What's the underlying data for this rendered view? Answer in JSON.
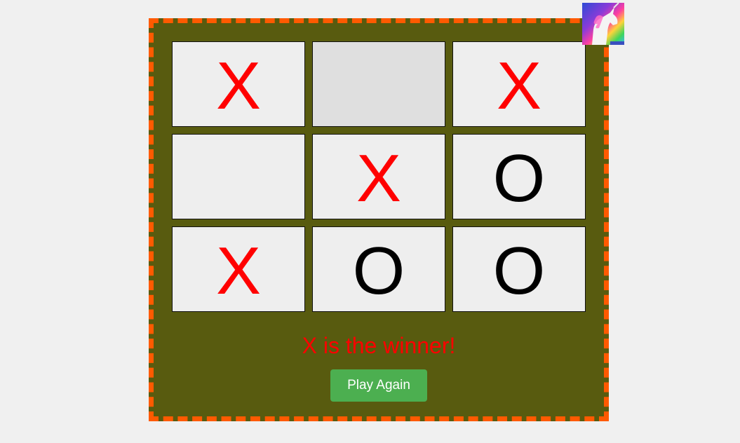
{
  "board": {
    "cells": [
      {
        "mark": "X",
        "player": "x"
      },
      {
        "mark": "",
        "player": "empty",
        "hover": true
      },
      {
        "mark": "X",
        "player": "x"
      },
      {
        "mark": "",
        "player": "empty"
      },
      {
        "mark": "X",
        "player": "x"
      },
      {
        "mark": "O",
        "player": "o"
      },
      {
        "mark": "X",
        "player": "x"
      },
      {
        "mark": "O",
        "player": "o"
      },
      {
        "mark": "O",
        "player": "o"
      }
    ]
  },
  "status": {
    "message": "X is the winner!"
  },
  "controls": {
    "play_again_label": "Play Again"
  },
  "colors": {
    "board_bg": "#585b0f",
    "border_dash": "#ff5a00",
    "x_mark": "#ff0000",
    "o_mark": "#000000",
    "button_bg": "#4caf50"
  },
  "decor": {
    "corner_image": "unicorn-rainbow-image"
  }
}
